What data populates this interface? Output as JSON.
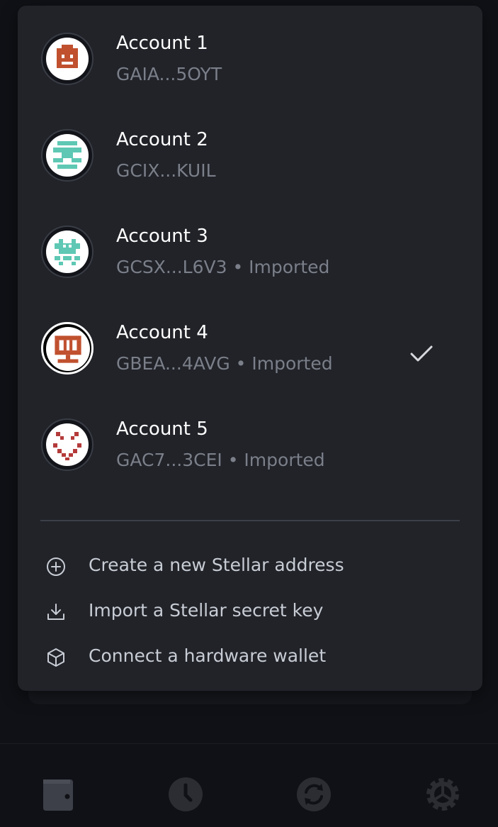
{
  "accounts": [
    {
      "name": "Account 1",
      "address": "GAIA...5OYT",
      "tag": "",
      "selected": false,
      "avatar_color": "#c0502e",
      "avatar_icon": "robot-face-identicon"
    },
    {
      "name": "Account 2",
      "address": "GCIX...KUIL",
      "tag": "",
      "selected": false,
      "avatar_color": "#5ec8b4",
      "avatar_icon": "bars-identicon"
    },
    {
      "name": "Account 3",
      "address": "GCSX...L6V3",
      "tag": "• Imported",
      "selected": false,
      "avatar_color": "#5ec8b4",
      "avatar_icon": "invader-identicon"
    },
    {
      "name": "Account 4",
      "address": "GBEA...4AVG",
      "tag": "• Imported",
      "selected": true,
      "avatar_color": "#c0502e",
      "avatar_icon": "glyph-identicon"
    },
    {
      "name": "Account 5",
      "address": "GAC7...3CEI",
      "tag": "• Imported",
      "selected": false,
      "avatar_color": "#b43a3a",
      "avatar_icon": "smile-identicon"
    }
  ],
  "actions": {
    "create_label": "Create a new Stellar address",
    "import_label": "Import a Stellar secret key",
    "hardware_label": "Connect a hardware wallet"
  },
  "tabbar": {
    "items": [
      "wallet-icon",
      "history-icon",
      "swap-icon",
      "settings-icon"
    ]
  },
  "colors": {
    "background": "#0f1116",
    "popover": "#212329",
    "primary_text": "#ffffff",
    "secondary_text": "#7b7f89"
  }
}
